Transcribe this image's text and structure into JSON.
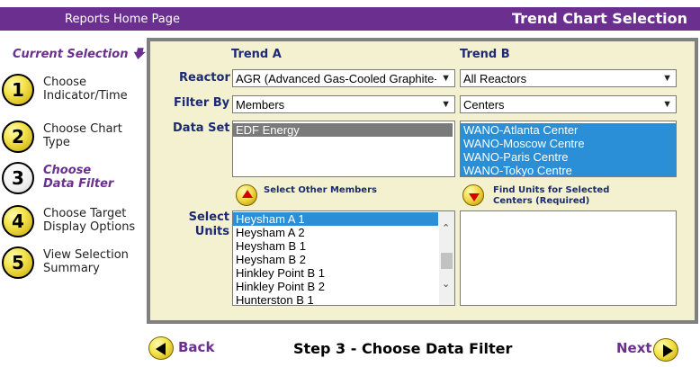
{
  "header": {
    "home_link": "Reports Home Page",
    "title": "Trend Chart Selection"
  },
  "sidebar": {
    "current_selection": "Current Selection",
    "steps": [
      {
        "num": "1",
        "line1": "Choose",
        "line2": "Indicator/Time"
      },
      {
        "num": "2",
        "line1": "Choose Chart",
        "line2": "Type"
      },
      {
        "num": "3",
        "line1": "Choose",
        "line2": "Data Filter"
      },
      {
        "num": "4",
        "line1": "Choose Target",
        "line2": "Display Options"
      },
      {
        "num": "5",
        "line1": "View Selection",
        "line2": "Summary"
      }
    ]
  },
  "form": {
    "trend_a": "Trend A",
    "trend_b": "Trend B",
    "reactor_label": "Reactor",
    "filter_label": "Filter By",
    "dataset_label": "Data Set",
    "units_label_1": "Select",
    "units_label_2": "Units",
    "reactor_a": "AGR (Advanced Gas-Cooled Graphite-",
    "reactor_b": "All Reactors",
    "filter_a": "Members",
    "filter_b": "Centers",
    "dataset_a": [
      "EDF Energy"
    ],
    "dataset_b": [
      "WANO-Atlanta Center",
      "WANO-Moscow Centre",
      "WANO-Paris Centre",
      "WANO-Tokyo Centre"
    ],
    "select_other_members": "Select Other Members",
    "find_units_1": "Find Units for Selected",
    "find_units_2": "Centers (Required)",
    "units_a": [
      "Heysham A 1",
      "Heysham A 2",
      "Heysham B 1",
      "Heysham B 2",
      "Hinkley Point B 1",
      "Hinkley Point B 2",
      "Hunterston B 1"
    ]
  },
  "footer": {
    "back": "Back",
    "step_title": "Step 3 - Choose Data Filter",
    "next": "Next"
  },
  "colors": {
    "purple": "#6a2f8f",
    "navy": "#1c2a75",
    "panel": "#f4f1d0",
    "selected": "#2a8fd6"
  }
}
